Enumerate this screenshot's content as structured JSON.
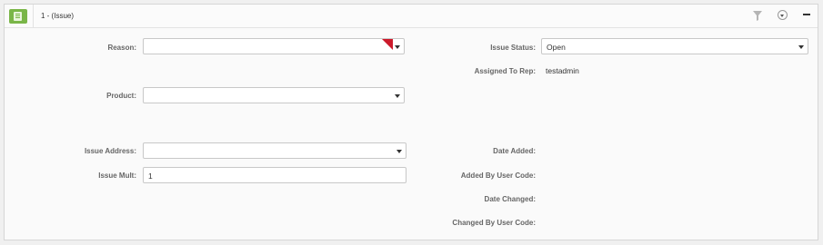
{
  "header": {
    "title": "1 - (Issue)",
    "icon": "notebook-icon",
    "actions": [
      "filter-icon",
      "dropdown-circle-icon",
      "collapse-icon"
    ]
  },
  "form": {
    "reason": {
      "label": "Reason:",
      "value": ""
    },
    "product": {
      "label": "Product:",
      "value": ""
    },
    "issue_address": {
      "label": "Issue Address:",
      "value": ""
    },
    "issue_mult": {
      "label": "Issue Mult:",
      "value": "1"
    },
    "issue_status": {
      "label": "Issue Status:",
      "value": "Open"
    },
    "assigned_to_rep": {
      "label": "Assigned To Rep:",
      "value": "testadmin"
    },
    "date_added": {
      "label": "Date Added:",
      "value": ""
    },
    "added_by_user_code": {
      "label": "Added By User Code:",
      "value": ""
    },
    "date_changed": {
      "label": "Date Changed:",
      "value": ""
    },
    "changed_by_user_code": {
      "label": "Changed By User Code:",
      "value": ""
    }
  },
  "colors": {
    "accent_green": "#7ab648",
    "required_red": "#cc1a2b"
  }
}
